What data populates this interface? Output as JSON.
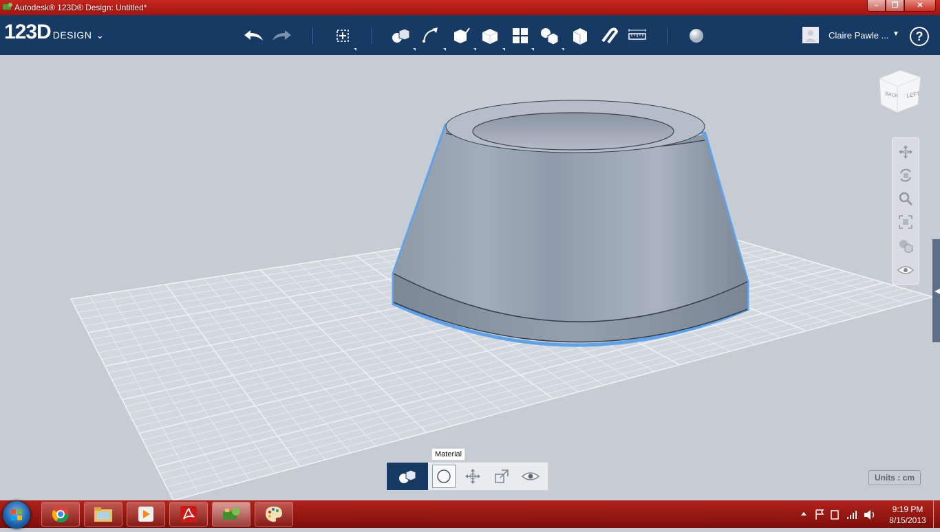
{
  "window": {
    "title": "Autodesk® 123D® Design: Untitled*"
  },
  "toolbar": {
    "logo_number": "123D",
    "logo_word": "DESIGN",
    "user_name": "Claire Pawle ...",
    "help_label": "?"
  },
  "viewport": {
    "viewcube_faces": {
      "front": "LEFT",
      "side": "BACK"
    },
    "units_label": "Units : cm"
  },
  "context_bar": {
    "tooltip": "Material"
  },
  "taskbar": {
    "time": "9:19 PM",
    "date": "8/15/2013",
    "apps": [
      "chrome",
      "file-explorer",
      "media-player",
      "adobe-reader",
      "123d-design",
      "paint"
    ]
  },
  "colors": {
    "titlebar": "#b81f18",
    "toolbar": "#163a63",
    "viewport_bg": "#c6ccd3",
    "selection_outline": "#5fa2ec",
    "taskbar": "#9c1a13"
  }
}
